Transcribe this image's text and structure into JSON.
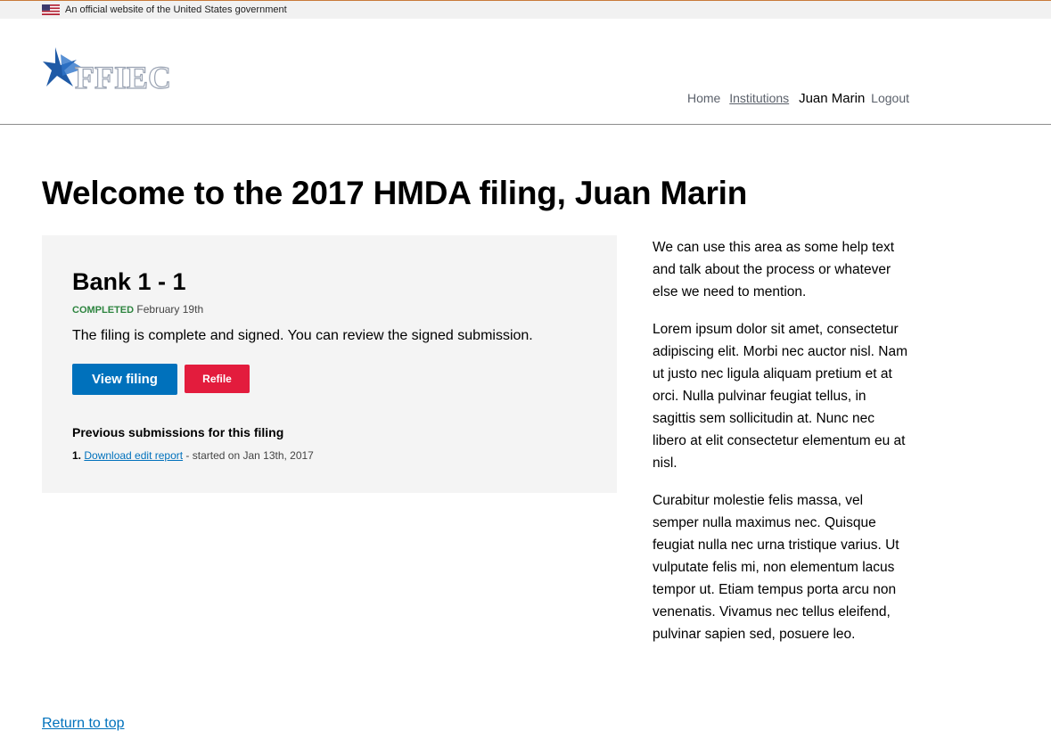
{
  "gov_banner": {
    "text": "An official website of the United States government"
  },
  "header": {
    "logo_text": "FFIEC",
    "nav": {
      "home": "Home",
      "institutions": "Institutions",
      "user": "Juan Marin",
      "logout": "Logout"
    }
  },
  "main": {
    "title": "Welcome to the 2017 HMDA filing, Juan Marin",
    "institution": {
      "name": "Bank 1 - 1",
      "status": "COMPLETED",
      "status_date": "February 19th",
      "message": "The filing is complete and signed. You can review the signed submission.",
      "view_button": "View filing",
      "refile_button": "Refile",
      "previous_heading": "Previous submissions for this filing",
      "previous": [
        {
          "number": "1.",
          "link": "Download edit report",
          "suffix": " - started on Jan 13th, 2017"
        }
      ]
    },
    "help": [
      "We can use this area as some help text and talk about the process or whatever else we need to mention.",
      "Lorem ipsum dolor sit amet, consectetur adipiscing elit. Morbi nec auctor nisl. Nam ut justo nec ligula aliquam pretium et at orci. Nulla pulvinar feugiat tellus, in sagittis sem sollicitudin at. Nunc nec libero at elit consectetur elementum eu at nisl.",
      "Curabitur molestie felis massa, vel semper nulla maximus nec. Quisque feugiat nulla nec urna tristique varius. Ut vulputate felis mi, non elementum lacus tempor ut. Etiam tempus porta arcu non venenatis. Vivamus nec tellus eleifend, pulvinar sapien sed, posuere leo."
    ]
  },
  "footer": {
    "return_to_top": "Return to top"
  },
  "colors": {
    "link": "#0071bc",
    "primary_button": "#0071bc",
    "refile_button": "#e31c3d",
    "completed": "#2e8540",
    "card_bg": "#f4f4f4"
  }
}
